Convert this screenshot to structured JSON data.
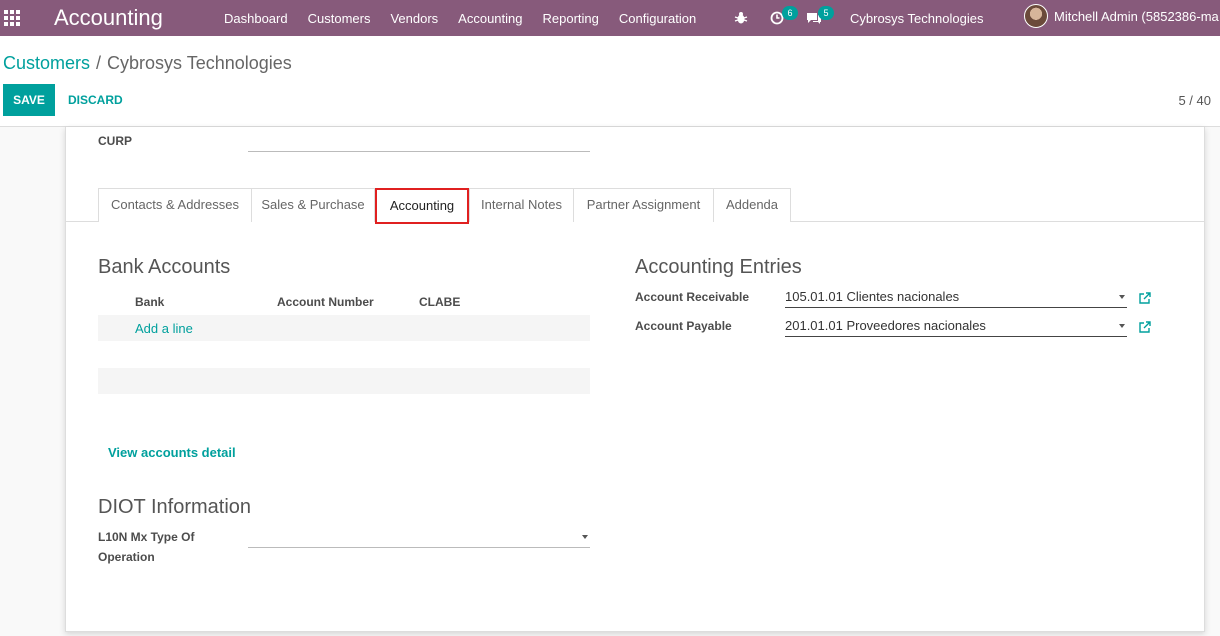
{
  "navbar": {
    "brand": "Accounting",
    "menu": [
      "Dashboard",
      "Customers",
      "Vendors",
      "Accounting",
      "Reporting",
      "Configuration"
    ],
    "activity_count": "6",
    "messages_count": "5",
    "company": "Cybrosys Technologies",
    "user": "Mitchell Admin (5852386-ma"
  },
  "control": {
    "breadcrumb_parent": "Customers",
    "breadcrumb_separator": "/",
    "breadcrumb_current": "Cybrosys Technologies",
    "save_label": "SAVE",
    "discard_label": "DISCARD",
    "pager": "5 / 40"
  },
  "form": {
    "curp_label": "CURP",
    "curp_value": "",
    "tabs": [
      "Contacts & Addresses",
      "Sales & Purchase",
      "Accounting",
      "Internal Notes",
      "Partner Assignment",
      "Addenda"
    ],
    "active_tab": "Accounting",
    "bank": {
      "title": "Bank Accounts",
      "columns": [
        "Bank",
        "Account Number",
        "CLABE"
      ],
      "add_line": "Add a line",
      "view_detail": "View accounts detail"
    },
    "entries": {
      "title": "Accounting Entries",
      "receivable_label": "Account Receivable",
      "receivable_value": "105.01.01 Clientes nacionales",
      "payable_label": "Account Payable",
      "payable_value": "201.01.01 Proveedores nacionales"
    },
    "diot": {
      "title": "DIOT Information",
      "type_label_1": "L10N Mx Type Of",
      "type_label_2": "Operation",
      "type_value": ""
    }
  },
  "colors": {
    "navbar": "#875a7b",
    "accent": "#00a09d",
    "highlight": "#e02020"
  }
}
